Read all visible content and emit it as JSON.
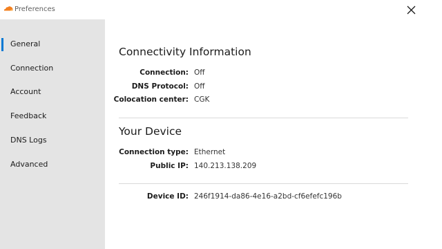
{
  "window": {
    "title": "Preferences",
    "close_icon": "close-icon",
    "app_icon": "cloud-icon",
    "accent_color": "#0078d4",
    "app_icon_color": "#f38020"
  },
  "sidebar": {
    "items": [
      {
        "label": "General",
        "selected": true
      },
      {
        "label": "Connection",
        "selected": false
      },
      {
        "label": "Account",
        "selected": false
      },
      {
        "label": "Feedback",
        "selected": false
      },
      {
        "label": "DNS Logs",
        "selected": false
      },
      {
        "label": "Advanced",
        "selected": false
      }
    ]
  },
  "connectivity": {
    "title": "Connectivity Information",
    "rows": [
      {
        "key": "Connection:",
        "value": "Off"
      },
      {
        "key": "DNS Protocol:",
        "value": "Off"
      },
      {
        "key": "Colocation center:",
        "value": "CGK"
      }
    ]
  },
  "device": {
    "title": "Your Device",
    "rows": [
      {
        "key": "Connection type:",
        "value": "Ethernet"
      },
      {
        "key": "Public IP:",
        "value": "140.213.138.209"
      }
    ]
  },
  "device_id": {
    "key": "Device ID:",
    "value": "246f1914-da86-4e16-a2bd-cf6efefc196b"
  }
}
